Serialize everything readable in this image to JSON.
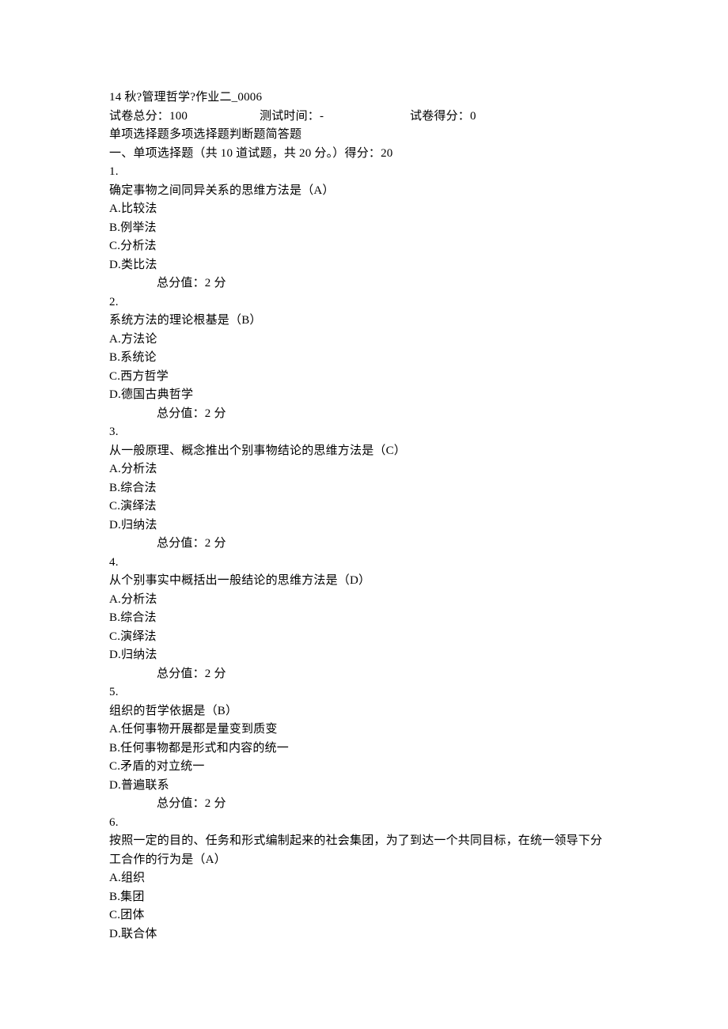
{
  "header": {
    "title_line": "14 秋?管理哲学?作业二_0006",
    "meta_total": "试卷总分：100",
    "meta_time": "测试时间：-",
    "meta_score": "试卷得分：0",
    "sections_line": "单项选择题多项选择题判断题简答题",
    "section1_title": "一、单项选择题（共 10 道试题，共 20 分。）得分：20"
  },
  "q1": {
    "num": "1.",
    "stem": "确定事物之间同异关系的思维方法是（A）",
    "a": "A.比较法",
    "b": "B.例举法",
    "c": "C.分析法",
    "d": "D.类比法",
    "score": "总分值：2 分"
  },
  "q2": {
    "num": "2.",
    "stem": "系统方法的理论根基是（B）",
    "a": "A.方法论",
    "b": "B.系统论",
    "c": "C.西方哲学",
    "d": "D.德国古典哲学",
    "score": "总分值：2 分"
  },
  "q3": {
    "num": "3.",
    "stem": "从一般原理、概念推出个别事物结论的思维方法是（C）",
    "a": "A.分析法",
    "b": "B.综合法",
    "c": "C.演绎法",
    "d": "D.归纳法",
    "score": "总分值：2 分"
  },
  "q4": {
    "num": "4.",
    "stem": "从个别事实中概括出一般结论的思维方法是（D）",
    "a": "A.分析法",
    "b": "B.综合法",
    "c": "C.演绎法",
    "d": "D.归纳法",
    "score": "总分值：2 分"
  },
  "q5": {
    "num": "5.",
    "stem": "组织的哲学依据是（B）",
    "a": "A.任何事物开展都是量变到质变",
    "b": "B.任何事物都是形式和内容的统一",
    "c": "C.矛盾的对立统一",
    "d": "D.普遍联系",
    "score": "总分值：2 分"
  },
  "q6": {
    "num": "6.",
    "stem_l1": "按照一定的目的、任务和形式编制起来的社会集团，为了到达一个共同目标，在统一领导下分",
    "stem_l2": "工合作的行为是（A）",
    "a": "A.组织",
    "b": "B.集团",
    "c": "C.团体",
    "d": "D.联合体"
  }
}
